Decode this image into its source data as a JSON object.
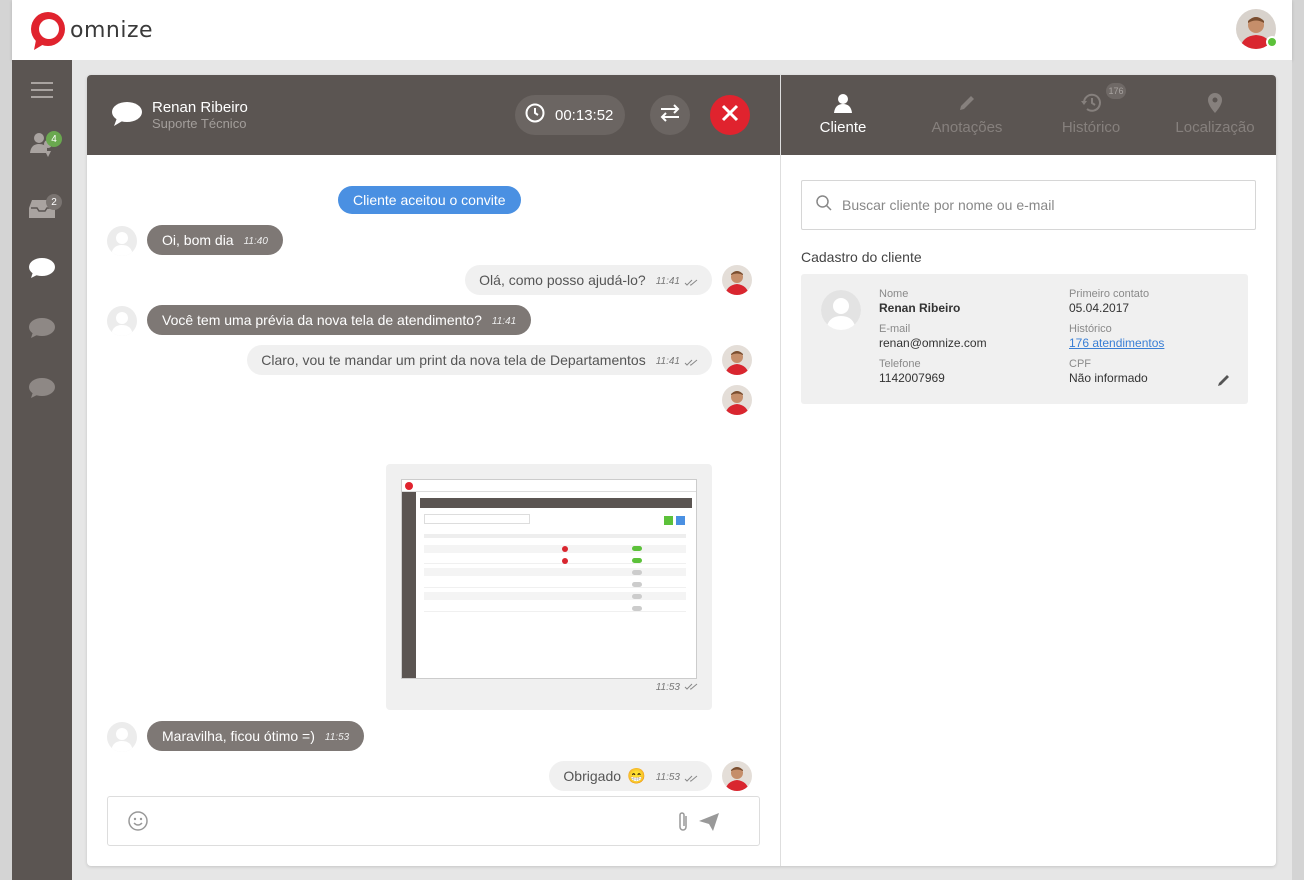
{
  "app": {
    "logo_text": "omnize"
  },
  "colors": {
    "brand_red": "#e0232e",
    "header_dark": "#5b5552",
    "system_blue": "#4a90e2",
    "online_green": "#5cc13a"
  },
  "sidebar": {
    "items": [
      {
        "icon": "menu-icon"
      },
      {
        "icon": "user-location-icon",
        "badge": "4",
        "badge_color": "#6aa84f"
      },
      {
        "icon": "inbox-icon",
        "badge": "2",
        "badge_color": "#7a7471"
      },
      {
        "icon": "chat-icon-active"
      },
      {
        "icon": "chat-icon"
      },
      {
        "icon": "chat-icon"
      }
    ]
  },
  "chat_header": {
    "name": "Renan Ribeiro",
    "department": "Suporte Técnico",
    "timer": "00:13:52"
  },
  "right_tabs": [
    {
      "label": "Cliente",
      "icon": "user-icon",
      "active": true
    },
    {
      "label": "Anotações",
      "icon": "pencil-icon"
    },
    {
      "label": "Histórico",
      "icon": "history-icon",
      "badge": "176"
    },
    {
      "label": "Localização",
      "icon": "location-pin-icon"
    }
  ],
  "messages": {
    "system": "Cliente aceitou o convite",
    "m1": {
      "text": "Oi, bom dia",
      "time": "11:40"
    },
    "m2": {
      "text": "Olá, como posso ajudá-lo?",
      "time": "11:41"
    },
    "m3": {
      "text": "Você tem uma prévia da nova tela de atendimento?",
      "time": "11:41"
    },
    "m4": {
      "text": "Claro, vou te mandar um print da nova tela de Departamentos",
      "time": "11:41"
    },
    "m5": {
      "time": "11:53"
    },
    "m6": {
      "text": "Maravilha, ficou ótimo =)",
      "time": "11:53"
    },
    "m7": {
      "text": "Obrigado",
      "emoji": "😁",
      "time": "11:53"
    }
  },
  "right_panel": {
    "search_placeholder": "Buscar cliente por nome ou e-mail",
    "section_title": "Cadastro do cliente",
    "client": {
      "name_label": "Nome",
      "name": "Renan Ribeiro",
      "email_label": "E-mail",
      "email": "renan@omnize.com",
      "phone_label": "Telefone",
      "phone": "1142007969",
      "first_contact_label": "Primeiro contato",
      "first_contact": "05.04.2017",
      "history_label": "Histórico",
      "history": "176 atendimentos",
      "cpf_label": "CPF",
      "cpf": "Não informado"
    }
  }
}
